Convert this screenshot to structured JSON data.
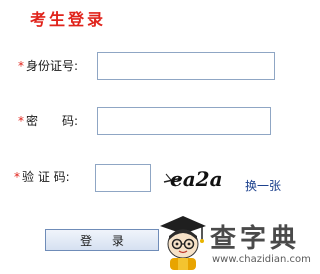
{
  "form": {
    "title": "考生登录",
    "required_mark": "*",
    "id_label": "身份证号:",
    "password_label": "密　　码:",
    "captcha_label": "验 证 码:",
    "id_value": "",
    "password_value": "",
    "captcha_value": "",
    "captcha_image_text": "ea2a",
    "refresh_label": "换一张",
    "login_label": "登 录"
  },
  "watermark": {
    "brand": "查字典",
    "url": "www.chazidian.com"
  },
  "colors": {
    "title": "#e0231b",
    "required": "#e0231b",
    "link": "#1a3f8c",
    "field_border": "#8fa6c4"
  }
}
